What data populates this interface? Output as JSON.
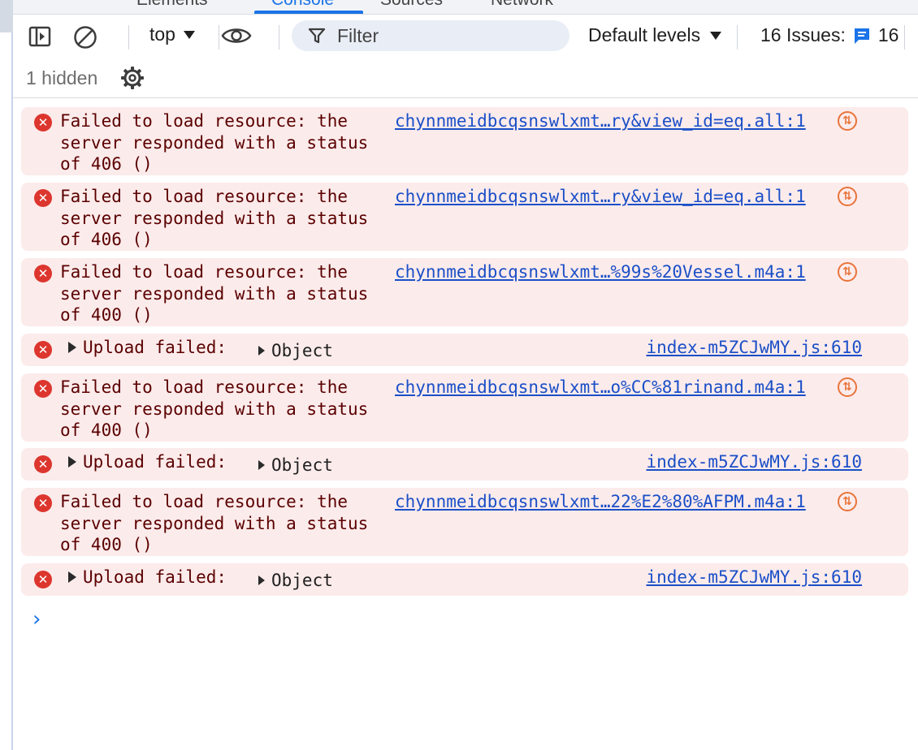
{
  "tabs": [
    {
      "label": "Elements"
    },
    {
      "label": "Console"
    },
    {
      "label": "Sources"
    },
    {
      "label": "Network"
    }
  ],
  "toolbar": {
    "context": "top",
    "filter_placeholder": "Filter",
    "levels": "Default levels",
    "issues_label": "16 Issues:",
    "issues_count": "16"
  },
  "status": {
    "hidden": "1 hidden"
  },
  "messages": [
    {
      "text": "Failed to load resource: the\nserver responded with a status\nof 406 ()",
      "link": "chynnmeidbcqsnswlxmt…ry&view_id=eq.all:1"
    },
    {
      "text": "Failed to load resource: the\nserver responded with a status\nof 406 ()",
      "link": "chynnmeidbcqsnswlxmt…ry&view_id=eq.all:1"
    },
    {
      "text": "Failed to load resource: the\nserver responded with a status\nof 400 ()",
      "link": "chynnmeidbcqsnswlxmt…%99s%20Vessel.m4a:1"
    },
    {
      "text": "Upload failed:",
      "object": "Object",
      "link": "index-m5ZCJwMY.js:610"
    },
    {
      "text": "Failed to load resource: the\nserver responded with a status\nof 400 ()",
      "link": "chynnmeidbcqsnswlxmt…o%CC%81rinand.m4a:1"
    },
    {
      "text": "Upload failed:",
      "object": "Object",
      "link": "index-m5ZCJwMY.js:610"
    },
    {
      "text": "Failed to load resource: the\nserver responded with a status\nof 400 ()",
      "link": "chynnmeidbcqsnswlxmt…22%E2%80%AFPM.m4a:1"
    },
    {
      "text": "Upload failed:",
      "object": "Object",
      "link": "index-m5ZCJwMY.js:610"
    }
  ],
  "icons": {
    "error": "error-icon",
    "network": "network-request-icon",
    "prompt": "chevron-right-icon"
  },
  "colors": {
    "accent": "#1a73e8",
    "error_bg": "#fcebeb",
    "error_icon": "#dc362e",
    "error_text": "#5b0000",
    "link": "#1a4fc8",
    "network_icon": "#e8743b"
  }
}
